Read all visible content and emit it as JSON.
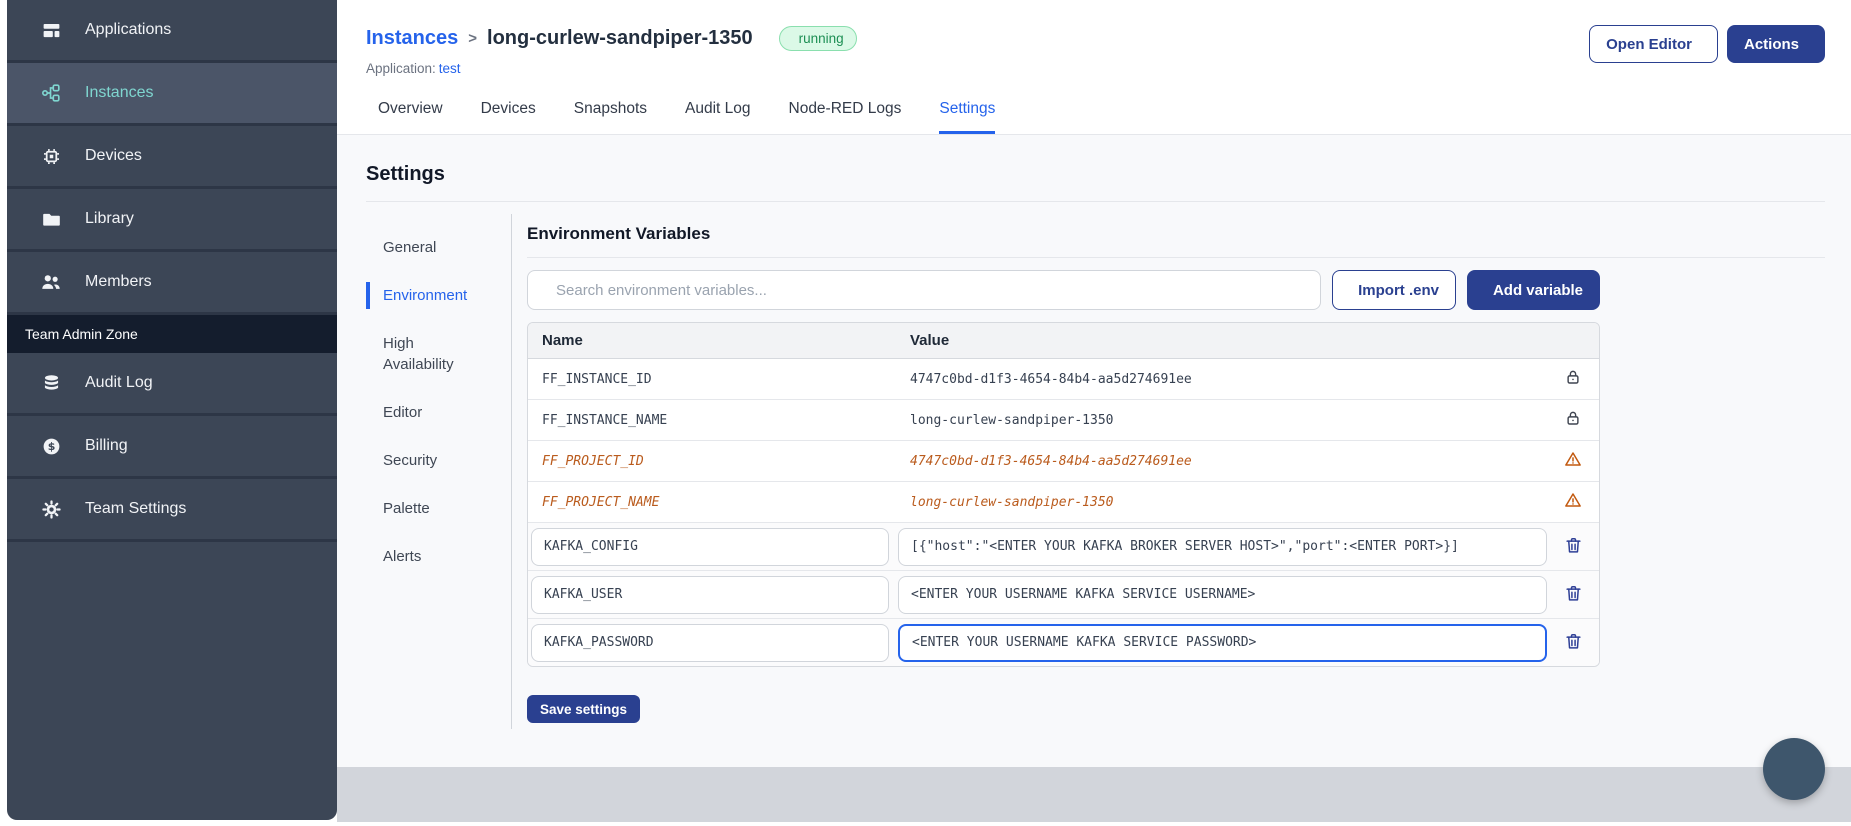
{
  "colors": {
    "sidebar_bg": "#3C4656",
    "sidebar_active_bg": "#4B5568",
    "sidebar_active_text": "#7FD6D0",
    "link_blue": "#2563EB",
    "button_navy": "#2A4090",
    "status_green": "#1D8F54",
    "deprecated_orange": "#BA5B1D",
    "footer_gray": "#D2D5DB"
  },
  "sidebar": {
    "items": [
      {
        "label": "Applications",
        "icon": "applications-icon",
        "active": false
      },
      {
        "label": "Instances",
        "icon": "instances-icon",
        "active": true
      },
      {
        "label": "Devices",
        "icon": "devices-icon",
        "active": false
      },
      {
        "label": "Library",
        "icon": "library-icon",
        "active": false
      },
      {
        "label": "Members",
        "icon": "members-icon",
        "active": false
      }
    ],
    "section_label": "Team Admin Zone",
    "admin_items": [
      {
        "label": "Audit Log",
        "icon": "audit-log-icon",
        "active": false
      },
      {
        "label": "Billing",
        "icon": "billing-icon",
        "active": false
      },
      {
        "label": "Team Settings",
        "icon": "team-settings-icon",
        "active": false
      }
    ]
  },
  "header": {
    "breadcrumb_parent": "Instances",
    "breadcrumb_separator": ">",
    "instance_name": "long-curlew-sandpiper-1350",
    "status_badge": "running",
    "application_label": "Application:",
    "application_name": "test",
    "open_editor_label": "Open Editor",
    "actions_label": "Actions"
  },
  "tabs": [
    {
      "label": "Overview",
      "active": false
    },
    {
      "label": "Devices",
      "active": false
    },
    {
      "label": "Snapshots",
      "active": false
    },
    {
      "label": "Audit Log",
      "active": false
    },
    {
      "label": "Node-RED Logs",
      "active": false
    },
    {
      "label": "Settings",
      "active": true
    }
  ],
  "settings": {
    "title": "Settings",
    "nav": [
      {
        "label": "General",
        "active": false
      },
      {
        "label": "Environment",
        "active": true
      },
      {
        "label": "High Availability",
        "active": false
      },
      {
        "label": "Editor",
        "active": false
      },
      {
        "label": "Security",
        "active": false
      },
      {
        "label": "Palette",
        "active": false
      },
      {
        "label": "Alerts",
        "active": false
      }
    ],
    "env": {
      "title": "Environment Variables",
      "search_placeholder": "Search environment variables...",
      "import_label": "Import .env",
      "add_label": "Add variable",
      "save_button": "Save settings",
      "table": {
        "columns": [
          "Name",
          "Value"
        ],
        "rows": [
          {
            "type": "static",
            "name": "FF_INSTANCE_ID",
            "value": "4747c0bd-d1f3-4654-84b4-aa5d274691ee",
            "icon": "lock-icon",
            "style": "normal"
          },
          {
            "type": "static",
            "name": "FF_INSTANCE_NAME",
            "value": "long-curlew-sandpiper-1350",
            "icon": "lock-icon",
            "style": "normal"
          },
          {
            "type": "static",
            "name": "FF_PROJECT_ID",
            "value": "4747c0bd-d1f3-4654-84b4-aa5d274691ee",
            "icon": "warning-icon",
            "style": "deprecated"
          },
          {
            "type": "static",
            "name": "FF_PROJECT_NAME",
            "value": "long-curlew-sandpiper-1350",
            "icon": "warning-icon",
            "style": "deprecated"
          },
          {
            "type": "editable",
            "name": "KAFKA_CONFIG",
            "value": "[{\"host\":\"<ENTER YOUR KAFKA BROKER SERVER HOST>\",\"port\":<ENTER PORT>}]",
            "icon": "trash-icon",
            "focused": false
          },
          {
            "type": "editable",
            "name": "KAFKA_USER",
            "value": "<ENTER YOUR USERNAME KAFKA SERVICE USERNAME>",
            "icon": "trash-icon",
            "focused": false
          },
          {
            "type": "editable",
            "name": "KAFKA_PASSWORD",
            "value": "<ENTER YOUR USERNAME KAFKA SERVICE PASSWORD>",
            "icon": "trash-icon",
            "focused": true
          }
        ]
      }
    }
  }
}
